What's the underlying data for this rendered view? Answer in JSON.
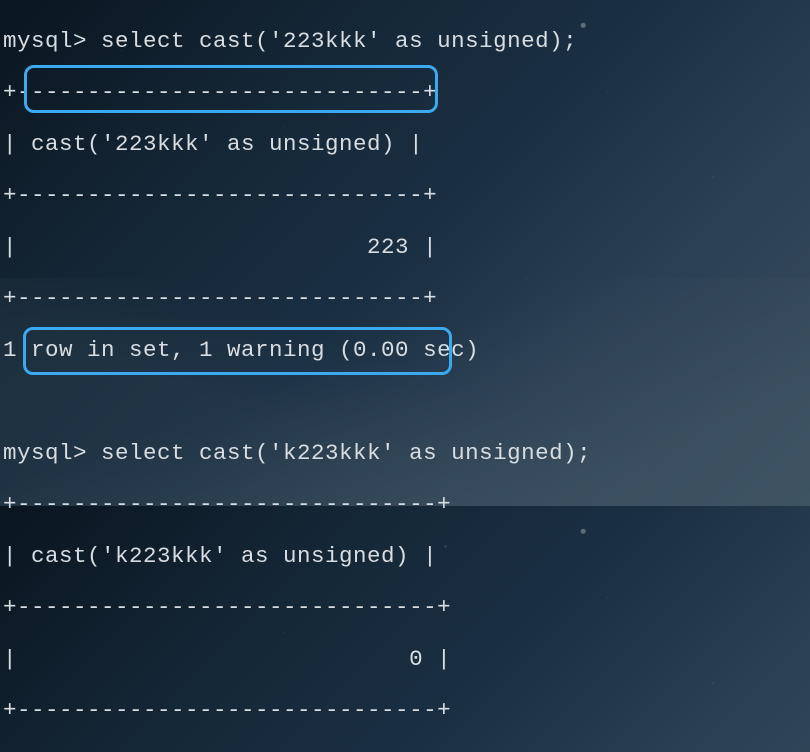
{
  "query1": {
    "prompt": "mysql> ",
    "sql": "select cast('223kkk' as unsigned);",
    "sep_top": "+-----------------------------+",
    "header": "| cast('223kkk' as unsigned) |",
    "sep_mid": "+-----------------------------+",
    "row": "|                         223 |",
    "sep_bot": "+-----------------------------+",
    "status": "1 row in set, 1 warning (0.00 sec)"
  },
  "query2": {
    "prompt": "mysql> ",
    "sql": "select cast('k223kkk' as unsigned);",
    "sep_top": "+------------------------------+",
    "header": "| cast('k223kkk' as unsigned) |",
    "sep_mid": "+------------------------------+",
    "row": "|                            0 |",
    "sep_bot": "+------------------------------+"
  }
}
